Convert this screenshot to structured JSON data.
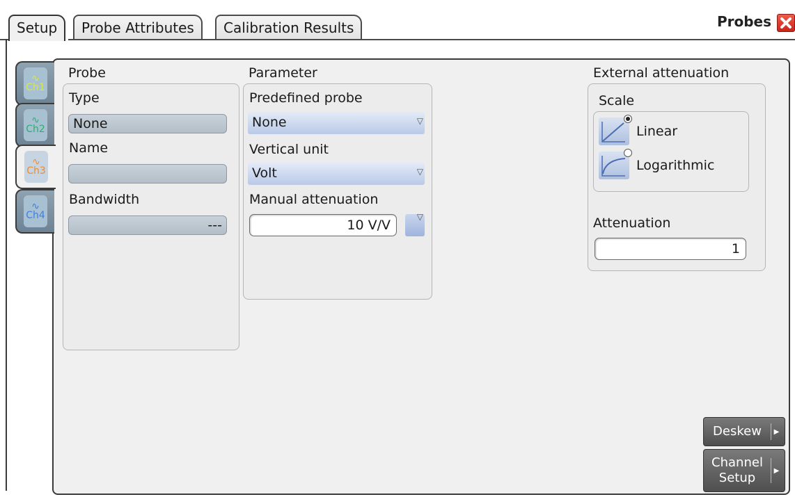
{
  "tabs": [
    {
      "label": "Setup",
      "active": true
    },
    {
      "label": "Probe Attributes",
      "active": false
    },
    {
      "label": "Calibration Results",
      "active": false
    }
  ],
  "window": {
    "title": "Probes",
    "close_icon": "close-icon",
    "close_color": "#d8321f"
  },
  "channels": [
    {
      "label": "Ch1",
      "color": "#d8e84a",
      "icon": "sine-wave-icon",
      "active": false
    },
    {
      "label": "Ch2",
      "color": "#2fae6a",
      "icon": "sine-wave-icon",
      "active": false
    },
    {
      "label": "Ch3",
      "color": "#f08a2c",
      "icon": "sine-wave-icon",
      "active": true
    },
    {
      "label": "Ch4",
      "color": "#3f7fe0",
      "icon": "sine-wave-icon",
      "active": false
    }
  ],
  "probe": {
    "title": "Probe",
    "type_label": "Type",
    "type_value": "None",
    "name_label": "Name",
    "name_value": "",
    "bandwidth_label": "Bandwidth",
    "bandwidth_value": "---"
  },
  "parameter": {
    "title": "Parameter",
    "predefined_label": "Predefined probe",
    "predefined_value": "None",
    "vertical_unit_label": "Vertical unit",
    "vertical_unit_value": "Volt",
    "manual_att_label": "Manual attenuation",
    "manual_att_value": "10 V/V"
  },
  "external": {
    "title": "External attenuation",
    "scale_label": "Scale",
    "linear_label": "Linear",
    "log_label": "Logarithmic",
    "selected_scale": "Linear",
    "attenuation_label": "Attenuation",
    "attenuation_value": "1"
  },
  "buttons": {
    "deskew": "Deskew",
    "channel_setup_line1": "Channel",
    "channel_setup_line2": "Setup"
  },
  "colors": {
    "accent_field": "#b9c9e8",
    "readonly_field": "#b8c3cc"
  }
}
